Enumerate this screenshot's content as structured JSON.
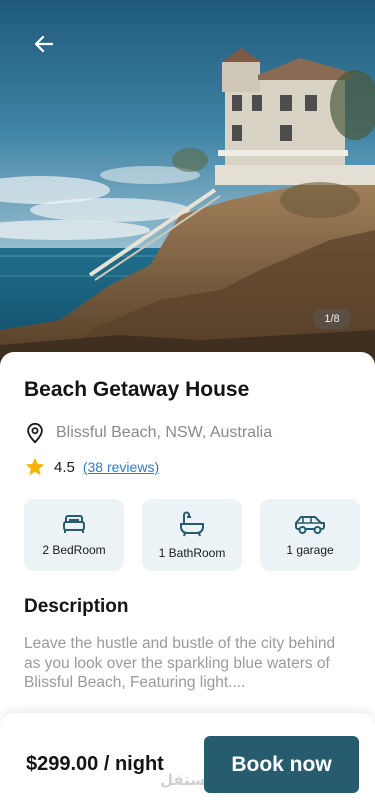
{
  "hero": {
    "image_desc_icon": "house-photo",
    "counter": "1/8"
  },
  "listing": {
    "title": "Beach Getaway House",
    "location": "Blissful Beach, NSW, Australia",
    "rating": "4.5",
    "reviews": "(38 reviews)"
  },
  "features": [
    {
      "icon": "bed-icon",
      "label": "2 BedRoom"
    },
    {
      "icon": "bathtub-icon",
      "label": "1 BathRoom"
    },
    {
      "icon": "car-icon",
      "label": "1 garage"
    }
  ],
  "description": {
    "heading": "Description",
    "text": "Leave the hustle and bustle of the city behind as you look over the sparkling blue waters of Blissful Beach, Featuring light...."
  },
  "footer": {
    "price": "$299.00 / night",
    "book_label": "Book now",
    "watermark": "مستقل"
  },
  "colors": {
    "accent": "#275b6e",
    "feature_bg": "#ecf3f6",
    "link": "#2f7dc2",
    "star": "#f5b400"
  }
}
